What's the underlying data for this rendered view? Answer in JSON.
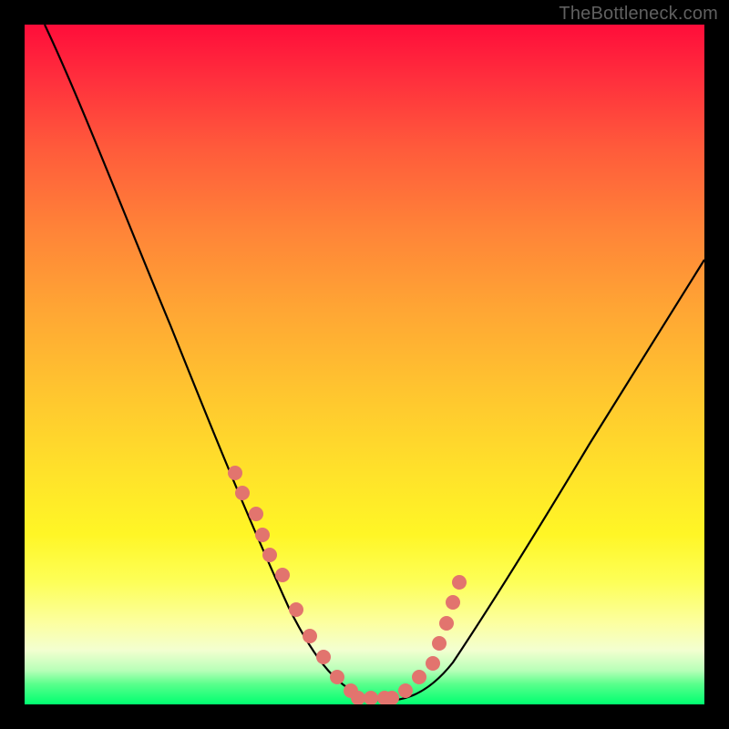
{
  "attribution": "TheBottleneck.com",
  "colors": {
    "frame": "#000000",
    "curve": "#000000",
    "dots": "#e2746e",
    "gradient_top": "#ff0d3a",
    "gradient_bottom": "#00ff70"
  },
  "chart_data": {
    "type": "line",
    "title": "",
    "xlabel": "",
    "ylabel": "",
    "xlim": [
      0,
      100
    ],
    "ylim": [
      0,
      100
    ],
    "grid": false,
    "series": [
      {
        "name": "bottleneck-curve",
        "x": [
          3,
          6,
          10,
          14,
          18,
          22,
          26,
          30,
          34,
          38,
          41,
          44,
          47,
          50,
          52,
          55,
          58,
          61,
          64,
          68,
          72,
          76,
          80,
          84,
          88,
          92,
          96,
          99
        ],
        "y": [
          100,
          91,
          80,
          70,
          61,
          52,
          44,
          36,
          29,
          22,
          17,
          12,
          8,
          4,
          2,
          1,
          1,
          2,
          5,
          9,
          14,
          20,
          26,
          32,
          38,
          44,
          50,
          55
        ]
      }
    ],
    "scatter_overlay": {
      "name": "data-dots",
      "x": [
        31,
        32,
        34,
        35,
        36,
        38,
        40,
        42,
        44,
        46,
        48,
        49,
        51,
        53,
        54,
        56,
        58,
        60,
        61,
        62,
        63,
        64
      ],
      "y": [
        34,
        31,
        28,
        25,
        22,
        19,
        14,
        10,
        7,
        4,
        2,
        1,
        1,
        1,
        1,
        2,
        4,
        6,
        9,
        12,
        15,
        18
      ]
    }
  }
}
